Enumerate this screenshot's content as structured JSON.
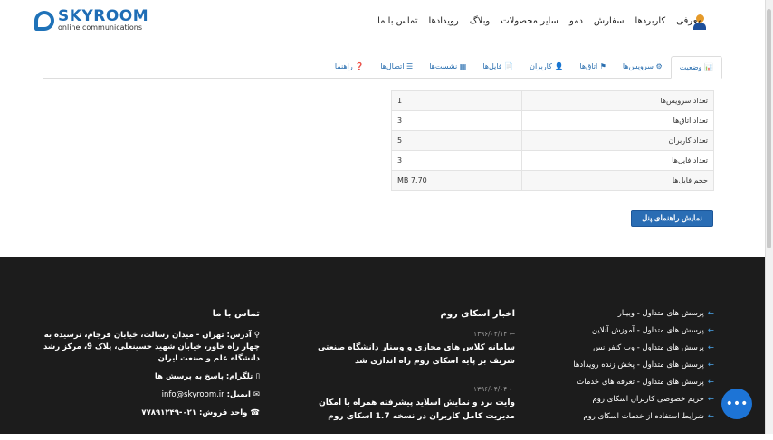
{
  "logo": {
    "name": "SKYROOM",
    "tagline": "online communications"
  },
  "nav": [
    "معرفی",
    "کاربردها",
    "سفارش",
    "دمو",
    "سایر محصولات",
    "وبلاگ",
    "رویدادها",
    "تماس با ما"
  ],
  "tabs": [
    {
      "icon": "📊",
      "label": "وضعیت"
    },
    {
      "icon": "⚙",
      "label": "سرویس‌ها"
    },
    {
      "icon": "⚑",
      "label": "اتاق‌ها"
    },
    {
      "icon": "👤",
      "label": "کاربران"
    },
    {
      "icon": "📄",
      "label": "فایل‌ها"
    },
    {
      "icon": "▦",
      "label": "نشست‌ها"
    },
    {
      "icon": "☰",
      "label": "اتصال‌ها"
    },
    {
      "icon": "❓",
      "label": "راهنما"
    }
  ],
  "stats": [
    {
      "label": "تعداد سرویس‌ها",
      "value": "1"
    },
    {
      "label": "تعداد اتاق‌ها",
      "value": "3"
    },
    {
      "label": "تعداد کاربران",
      "value": "5"
    },
    {
      "label": "تعداد فایل‌ها",
      "value": "3"
    },
    {
      "label": "حجم فایل‌ها",
      "value": "MB 7.70"
    }
  ],
  "guide_button": "نمایش راهنمای پنل",
  "footer": {
    "links": [
      "پرسش های متداول - وبینار",
      "پرسش های متداول - آموزش آنلاین",
      "پرسش های متداول - وب کنفرانس",
      "پرسش های متداول - پخش زنده رویدادها",
      "پرسش های متداول - تعرفه های خدمات",
      "حریم خصوصی کاربران اسکای روم",
      "شرایط استفاده از خدمات اسکای روم"
    ],
    "news_title": "اخبار اسکای روم",
    "news": [
      {
        "date": "۱۳۹۶/۰۴/۱۴",
        "text": "سامانه کلاس های مجازی و وبینار دانشگاه صنعتی شریف بر پایه اسکای روم راه اندازی شد"
      },
      {
        "date": "۱۳۹۶/۰۴/۰۴",
        "text": "وایت برد و نمایش اسلاید پیشرفته همراه با امکان مدیریت کامل کاربران در نسخه 1.7 اسکای روم"
      }
    ],
    "contact_title": "تماس با ما",
    "address": "آدرس: تهران - میدان رسالت، خیابان فرجام، نرسیده به چهار راه خاور، خیابان شهید حسینعلی، پلاک 9، مرکز رشد دانشگاه علم و صنعت ایران",
    "telegram": "تلگرام: پاسخ به پرسش ها",
    "email_label": "ایمیل:",
    "email": "info@skyroom.ir",
    "phone": "واحد فروش: ۰۲۱-۷۷۸۹۱۲۴۹"
  }
}
